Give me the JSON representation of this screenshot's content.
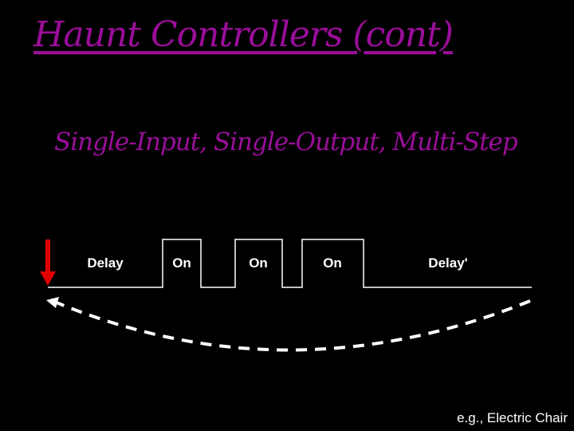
{
  "title": "Haunt Controllers (cont)",
  "subtitle": "Single-Input, Single-Output, Multi-Step",
  "diagram": {
    "segments": [
      {
        "label": "Delay",
        "state": "low"
      },
      {
        "label": "On",
        "state": "high"
      },
      {
        "label": "",
        "state": "low"
      },
      {
        "label": "On",
        "state": "high"
      },
      {
        "label": "",
        "state": "low"
      },
      {
        "label": "On",
        "state": "high"
      },
      {
        "label": "Delay'",
        "state": "low"
      }
    ],
    "trigger": "red-down-arrow",
    "loop": "dashed-return-arrow"
  },
  "example": "e.g., Electric Chair",
  "colors": {
    "title": "#9a0e9a",
    "trigger": "#e00000",
    "line": "#ffffff"
  }
}
